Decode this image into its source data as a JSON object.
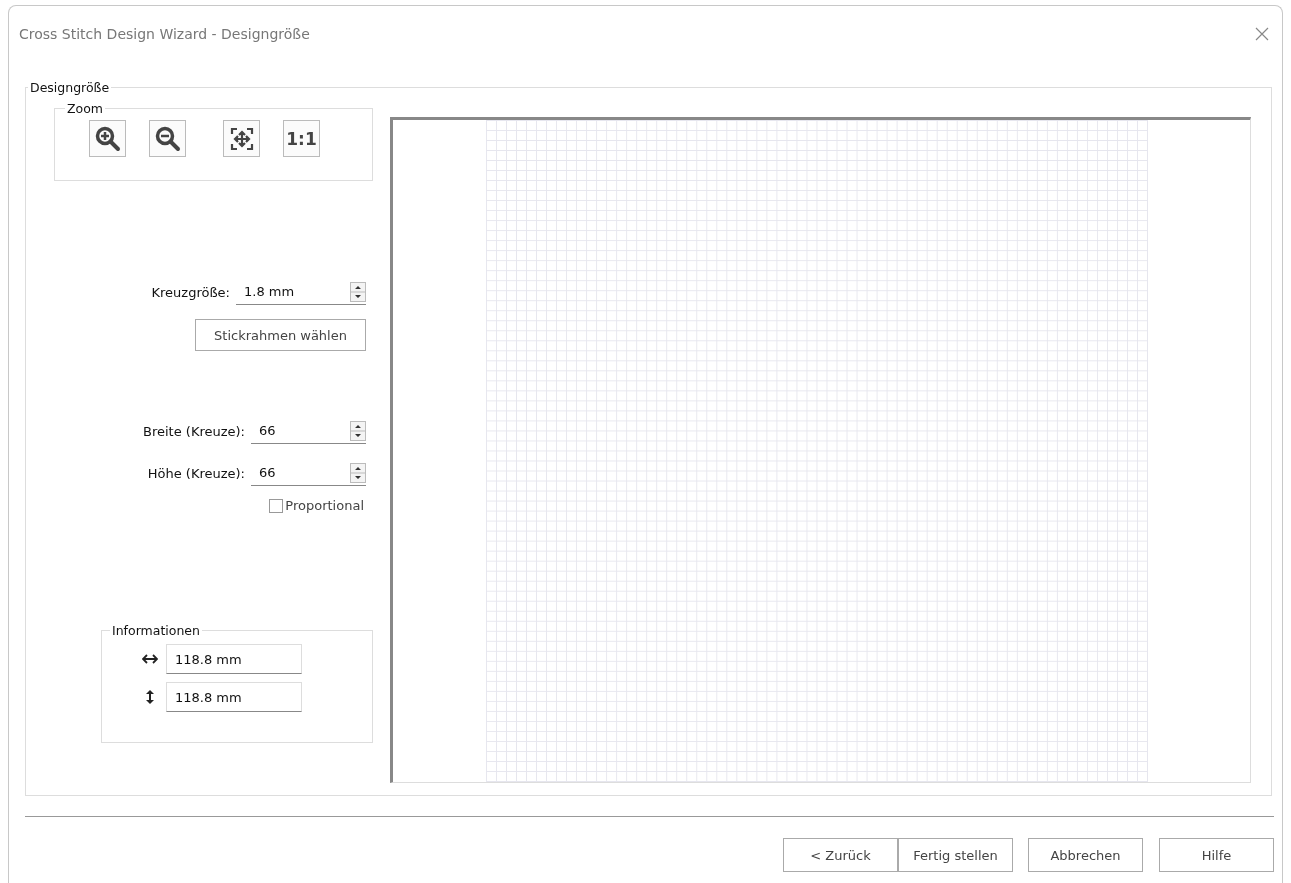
{
  "window": {
    "title": "Cross Stitch Design Wizard - Designgröße"
  },
  "design_size": {
    "title": "Designgröße",
    "zoom": {
      "title": "Zoom",
      "buttons": [
        {
          "kind": "zoom-in"
        },
        {
          "kind": "zoom-out"
        },
        {
          "kind": "fit"
        },
        {
          "kind": "actual",
          "label": "1:1"
        }
      ]
    },
    "stitch_size": {
      "label": "Kreuzgröße:",
      "value": "1.8 mm"
    },
    "hoop_button": "Stickrahmen wählen",
    "width": {
      "label": "Breite (Kreuze):",
      "value": "66"
    },
    "height": {
      "label": "Höhe (Kreuze):",
      "value": "66"
    },
    "proportional": {
      "label": "Proportional",
      "checked": false
    },
    "info": {
      "title": "Informationen",
      "rows": [
        {
          "kind": "horizontal",
          "value": "118.8 mm"
        },
        {
          "kind": "vertical",
          "value": "118.8 mm"
        }
      ]
    }
  },
  "buttons": [
    "< Zurück",
    "Fertig stellen",
    "Abbrechen",
    "Hilfe"
  ]
}
